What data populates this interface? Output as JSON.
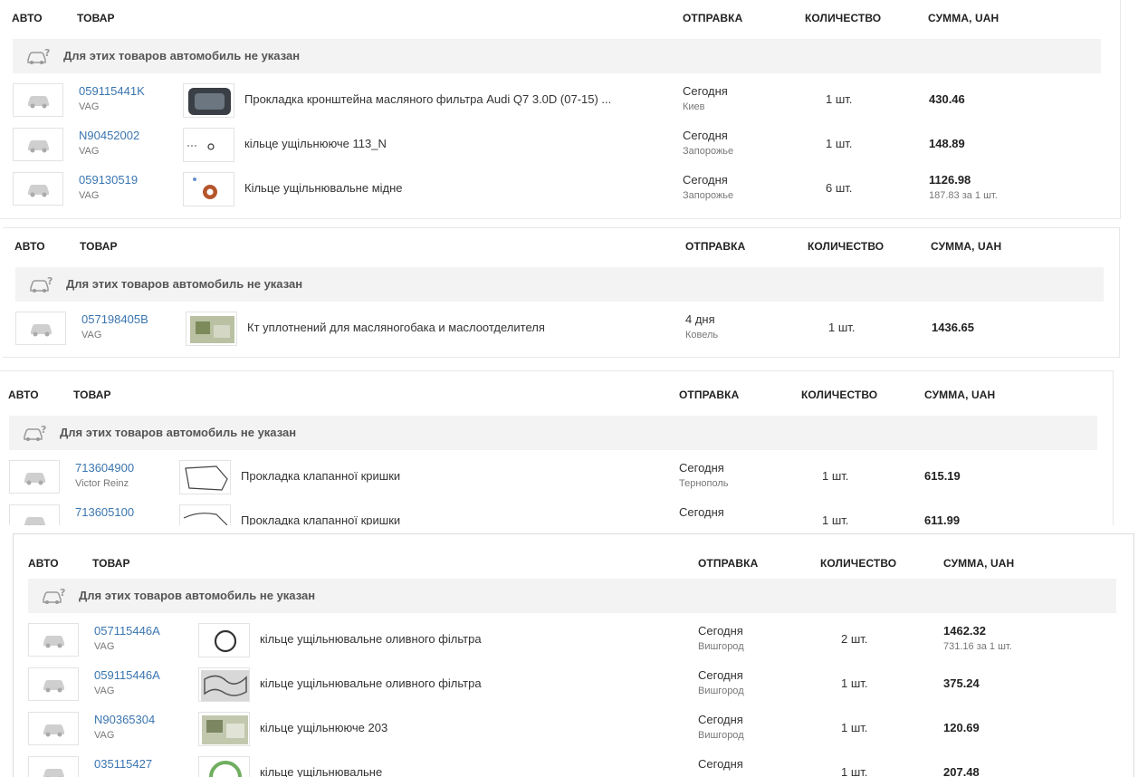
{
  "headers": {
    "auto": "АВТО",
    "product": "ТОВАР",
    "shipping": "ОТПРАВКА",
    "quantity": "КОЛИЧЕСТВО",
    "sum": "СУММА, UAH"
  },
  "no_auto_text": "Для этих товаров автомобиль не указан",
  "blocks": [
    {
      "items": [
        {
          "code": "059115441K",
          "brand": "VAG",
          "name": "Прокладка кронштейна масляного фильтра Audi Q7 3.0D (07-15) ...",
          "ship": "Сегодня",
          "city": "Киев",
          "qty": "1 шт.",
          "sum": "430.46",
          "per": ""
        },
        {
          "code": "N90452002",
          "brand": "VAG",
          "name": "кільце ущільнююче 113_N",
          "ship": "Сегодня",
          "city": "Запорожье",
          "qty": "1 шт.",
          "sum": "148.89",
          "per": ""
        },
        {
          "code": "059130519",
          "brand": "VAG",
          "name": "Кільце ущільнювальне мідне",
          "ship": "Сегодня",
          "city": "Запорожье",
          "qty": "6 шт.",
          "sum": "1126.98",
          "per": "187.83 за 1 шт."
        }
      ]
    },
    {
      "items": [
        {
          "code": "057198405B",
          "brand": "VAG",
          "name": "Кт уплотнений для масляногобака и маслоотделителя",
          "ship": "4 дня",
          "city": "Ковель",
          "qty": "1 шт.",
          "sum": "1436.65",
          "per": ""
        }
      ]
    },
    {
      "items": [
        {
          "code": "713604900",
          "brand": "Victor Reinz",
          "name": "Прокладка клапанної кришки",
          "ship": "Сегодня",
          "city": "Тернополь",
          "qty": "1 шт.",
          "sum": "615.19",
          "per": ""
        },
        {
          "code": "713605100",
          "brand": "",
          "name": "Прокладка клапанної кришки",
          "ship": "Сегодня",
          "city": "",
          "qty": "1 шт.",
          "sum": "611.99",
          "per": ""
        }
      ]
    },
    {
      "items": [
        {
          "code": "057115446A",
          "brand": "VAG",
          "name": "кільце ущільнювальне оливного фільтра",
          "ship": "Сегодня",
          "city": "Вишгород",
          "qty": "2 шт.",
          "sum": "1462.32",
          "per": "731.16 за 1 шт."
        },
        {
          "code": "059115446A",
          "brand": "VAG",
          "name": "кільце ущільнювальне оливного фільтра",
          "ship": "Сегодня",
          "city": "Вишгород",
          "qty": "1 шт.",
          "sum": "375.24",
          "per": ""
        },
        {
          "code": "N90365304",
          "brand": "VAG",
          "name": "кільце ущільнююче 203",
          "ship": "Сегодня",
          "city": "Вишгород",
          "qty": "1 шт.",
          "sum": "120.69",
          "per": ""
        },
        {
          "code": "035115427",
          "brand": "",
          "name": "кільце ущільнювальне",
          "ship": "Сегодня",
          "city": "",
          "qty": "1 шт.",
          "sum": "207.48",
          "per": ""
        }
      ]
    }
  ]
}
